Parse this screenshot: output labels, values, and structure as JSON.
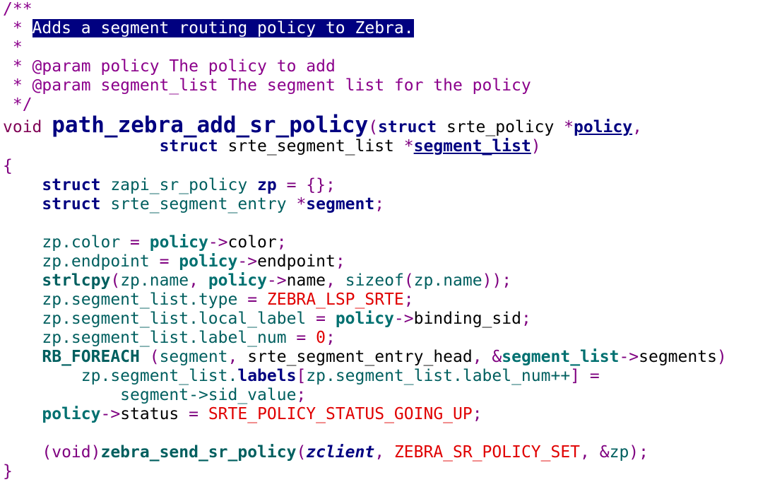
{
  "colors": {
    "comment": "#8b008b",
    "keyword": "#7f0055",
    "function_name": "#000080",
    "type_name": "#005f5f",
    "macro": "#e00000",
    "selection_bg": "#000080",
    "selection_fg": "#ffffff"
  },
  "code": {
    "lines": [
      [
        {
          "t": "/**",
          "c": "t-comment"
        }
      ],
      [
        {
          "t": " * ",
          "c": "t-comment"
        },
        {
          "t": "Adds a segment routing policy to Zebra.",
          "c": "t-highlight"
        }
      ],
      [
        {
          "t": " *",
          "c": "t-comment"
        }
      ],
      [
        {
          "t": " * @param policy The policy to add",
          "c": "t-comment"
        }
      ],
      [
        {
          "t": " * @param segment_list The segment list for the policy",
          "c": "t-comment"
        }
      ],
      [
        {
          "t": " */",
          "c": "t-comment"
        }
      ],
      [
        {
          "t": "void ",
          "c": "t-void"
        },
        {
          "t": "path_zebra_add_sr_policy",
          "c": "t-fnname"
        },
        {
          "t": "(",
          "c": "t-punct"
        },
        {
          "t": "struct",
          "c": "t-kwbold"
        },
        {
          "t": " srte_policy ",
          "c": "t-plain"
        },
        {
          "t": "*",
          "c": "t-punct"
        },
        {
          "t": "policy",
          "c": "t-paramul"
        },
        {
          "t": ",",
          "c": "t-punct"
        }
      ],
      [
        {
          "t": "                ",
          "c": "t-plain"
        },
        {
          "t": "struct",
          "c": "t-kwbold"
        },
        {
          "t": " srte_segment_list ",
          "c": "t-plain"
        },
        {
          "t": "*",
          "c": "t-punct"
        },
        {
          "t": "segment_list",
          "c": "t-paramul"
        },
        {
          "t": ")",
          "c": "t-punct"
        }
      ],
      [
        {
          "t": "{",
          "c": "t-brace"
        }
      ],
      [
        {
          "t": "    ",
          "c": "t-plain"
        },
        {
          "t": "struct",
          "c": "t-kwbold"
        },
        {
          "t": " zapi_sr_policy ",
          "c": "t-field"
        },
        {
          "t": "zp",
          "c": "t-param"
        },
        {
          "t": " = {};",
          "c": "t-punct"
        }
      ],
      [
        {
          "t": "    ",
          "c": "t-plain"
        },
        {
          "t": "struct",
          "c": "t-kwbold"
        },
        {
          "t": " srte_segment_entry ",
          "c": "t-field"
        },
        {
          "t": "*",
          "c": "t-punct"
        },
        {
          "t": "segment",
          "c": "t-param"
        },
        {
          "t": ";",
          "c": "t-punct"
        }
      ],
      [
        {
          "t": "",
          "c": "t-plain"
        }
      ],
      [
        {
          "t": "    ",
          "c": "t-plain"
        },
        {
          "t": "zp.color",
          "c": "t-field"
        },
        {
          "t": " = ",
          "c": "t-punct"
        },
        {
          "t": "policy",
          "c": "t-var"
        },
        {
          "t": "->",
          "c": "t-punct"
        },
        {
          "t": "color",
          "c": "t-plain"
        },
        {
          "t": ";",
          "c": "t-punct"
        }
      ],
      [
        {
          "t": "    ",
          "c": "t-plain"
        },
        {
          "t": "zp.endpoint",
          "c": "t-field"
        },
        {
          "t": " = ",
          "c": "t-punct"
        },
        {
          "t": "policy",
          "c": "t-var"
        },
        {
          "t": "->",
          "c": "t-punct"
        },
        {
          "t": "endpoint",
          "c": "t-plain"
        },
        {
          "t": ";",
          "c": "t-punct"
        }
      ],
      [
        {
          "t": "    ",
          "c": "t-plain"
        },
        {
          "t": "strlcpy",
          "c": "t-call"
        },
        {
          "t": "(",
          "c": "t-punct"
        },
        {
          "t": "zp.name",
          "c": "t-field"
        },
        {
          "t": ", ",
          "c": "t-punct"
        },
        {
          "t": "policy",
          "c": "t-var"
        },
        {
          "t": "->",
          "c": "t-punct"
        },
        {
          "t": "name",
          "c": "t-plain"
        },
        {
          "t": ", ",
          "c": "t-punct"
        },
        {
          "t": "sizeof",
          "c": "t-field"
        },
        {
          "t": "(",
          "c": "t-punct"
        },
        {
          "t": "zp.name",
          "c": "t-field"
        },
        {
          "t": "));",
          "c": "t-punct"
        }
      ],
      [
        {
          "t": "    ",
          "c": "t-plain"
        },
        {
          "t": "zp.segment_list.type",
          "c": "t-field"
        },
        {
          "t": " = ",
          "c": "t-punct"
        },
        {
          "t": "ZEBRA_LSP_SRTE",
          "c": "t-macro"
        },
        {
          "t": ";",
          "c": "t-punct"
        }
      ],
      [
        {
          "t": "    ",
          "c": "t-plain"
        },
        {
          "t": "zp.segment_list.local_label",
          "c": "t-field"
        },
        {
          "t": " = ",
          "c": "t-punct"
        },
        {
          "t": "policy",
          "c": "t-var"
        },
        {
          "t": "->",
          "c": "t-punct"
        },
        {
          "t": "binding_sid",
          "c": "t-plain"
        },
        {
          "t": ";",
          "c": "t-punct"
        }
      ],
      [
        {
          "t": "    ",
          "c": "t-plain"
        },
        {
          "t": "zp.segment_list.label_num",
          "c": "t-field"
        },
        {
          "t": " = ",
          "c": "t-punct"
        },
        {
          "t": "0",
          "c": "t-num"
        },
        {
          "t": ";",
          "c": "t-punct"
        }
      ],
      [
        {
          "t": "    ",
          "c": "t-plain"
        },
        {
          "t": "RB_FOREACH",
          "c": "t-call"
        },
        {
          "t": " (",
          "c": "t-punct"
        },
        {
          "t": "segment",
          "c": "t-field"
        },
        {
          "t": ", ",
          "c": "t-punct"
        },
        {
          "t": "srte_segment_entry_head",
          "c": "t-plain"
        },
        {
          "t": ", &",
          "c": "t-punct"
        },
        {
          "t": "segment_list",
          "c": "t-var"
        },
        {
          "t": "->",
          "c": "t-punct"
        },
        {
          "t": "segments",
          "c": "t-plain"
        },
        {
          "t": ")",
          "c": "t-punct"
        }
      ],
      [
        {
          "t": "        ",
          "c": "t-plain"
        },
        {
          "t": "zp.segment_list.",
          "c": "t-field"
        },
        {
          "t": "labels",
          "c": "t-param"
        },
        {
          "t": "[",
          "c": "t-punct"
        },
        {
          "t": "zp.segment_list.label_num++",
          "c": "t-field"
        },
        {
          "t": "] =",
          "c": "t-punct"
        }
      ],
      [
        {
          "t": "            ",
          "c": "t-plain"
        },
        {
          "t": "segment->sid_value",
          "c": "t-field"
        },
        {
          "t": ";",
          "c": "t-punct"
        }
      ],
      [
        {
          "t": "    ",
          "c": "t-plain"
        },
        {
          "t": "policy",
          "c": "t-var"
        },
        {
          "t": "->",
          "c": "t-punct"
        },
        {
          "t": "status",
          "c": "t-plain"
        },
        {
          "t": " = ",
          "c": "t-punct"
        },
        {
          "t": "SRTE_POLICY_STATUS_GOING_UP",
          "c": "t-macro"
        },
        {
          "t": ";",
          "c": "t-punct"
        }
      ],
      [
        {
          "t": "",
          "c": "t-plain"
        }
      ],
      [
        {
          "t": "    ",
          "c": "t-plain"
        },
        {
          "t": "(void)",
          "c": "t-punct"
        },
        {
          "t": "zebra_send_sr_policy",
          "c": "t-call"
        },
        {
          "t": "(",
          "c": "t-punct"
        },
        {
          "t": "zclient",
          "c": "t-italic"
        },
        {
          "t": ", ",
          "c": "t-punct"
        },
        {
          "t": "ZEBRA_SR_POLICY_SET",
          "c": "t-macro"
        },
        {
          "t": ", &",
          "c": "t-punct"
        },
        {
          "t": "zp",
          "c": "t-field"
        },
        {
          "t": ");",
          "c": "t-punct"
        }
      ],
      [
        {
          "t": "}",
          "c": "t-brace"
        }
      ]
    ]
  }
}
